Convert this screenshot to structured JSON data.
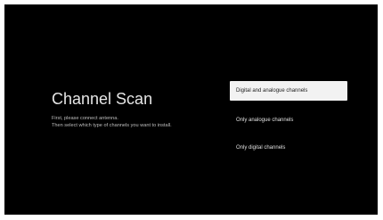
{
  "screen": {
    "title": "Channel Scan",
    "description_lines": [
      "First, please connect antenna.",
      "Then select which type of channels you want to install."
    ]
  },
  "options": [
    {
      "label": "Digital and analogue channels",
      "selected": true
    },
    {
      "label": "Only analogue channels",
      "selected": false
    },
    {
      "label": "Only digital channels",
      "selected": false
    }
  ],
  "colors": {
    "background": "#000000",
    "selected_bg": "#f2f2f2",
    "text": "#e6e6e6"
  }
}
